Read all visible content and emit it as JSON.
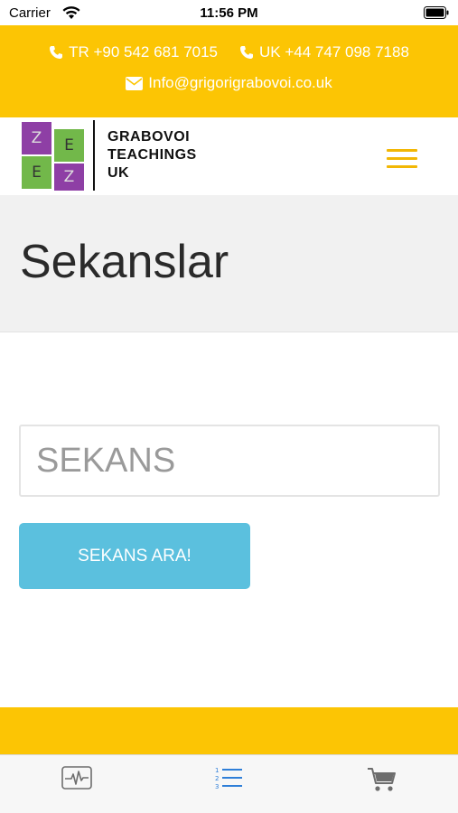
{
  "status_bar": {
    "carrier": "Carrier",
    "time": "11:56 PM"
  },
  "contact": {
    "phone_tr": "TR +90 542 681 7015",
    "phone_uk": "UK +44 747 098 7188",
    "email": "Info@grigorigrabovoi.co.uk",
    "icons": [
      "phone-icon",
      "phone-icon",
      "envelope-icon"
    ]
  },
  "header": {
    "logo_letters": [
      "Z",
      "E",
      "E",
      "Z"
    ],
    "logo_text_line1": "GRABOVOI",
    "logo_text_line2": "TEACHINGS",
    "logo_text_line3": "UK",
    "menu_icon": "hamburger-menu-icon"
  },
  "page": {
    "title": "Sekanslar"
  },
  "search": {
    "placeholder": "SEKANS",
    "button_label": "SEKANS ARA!"
  },
  "tab_bar": {
    "tabs": [
      {
        "icon": "activity-pulse-icon",
        "active": false
      },
      {
        "icon": "numbered-list-icon",
        "active": true
      },
      {
        "icon": "cart-icon",
        "active": false
      }
    ]
  },
  "colors": {
    "brand_yellow": "#fcc504",
    "menu_yellow": "#f2b705",
    "button_blue": "#5bc0de",
    "active_tab_blue": "#2f7fd8",
    "logo_purple": "#8e3fa5",
    "logo_green": "#72b84a"
  }
}
